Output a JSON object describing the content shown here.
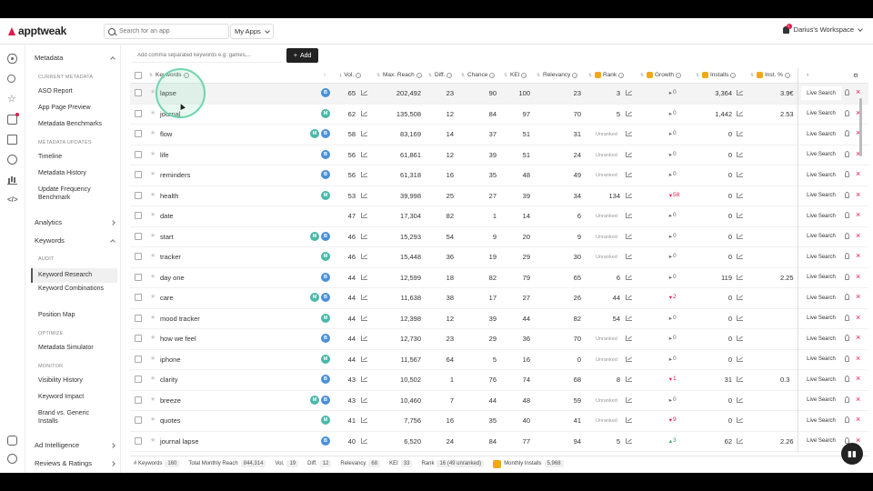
{
  "app": {
    "logo_text": "apptweak"
  },
  "topbar": {
    "search_placeholder": "Search for an app",
    "my_apps_label": "My Apps",
    "notification_count": "1",
    "workspace_label": "Darius's Workspace"
  },
  "rail_icons": [
    "eye-icon",
    "search-icon",
    "star-icon",
    "chat-icon",
    "box-icon",
    "clock-icon",
    "bar-chart-icon",
    "code-icon",
    "robot-icon",
    "user-icon"
  ],
  "nav": {
    "metadata": "Metadata",
    "current_metadata": "CURRENT METADATA",
    "aso_report": "ASO Report",
    "app_page_preview": "App Page Preview",
    "metadata_benchmarks": "Metadata Benchmarks",
    "metadata_updates": "METADATA UPDATES",
    "timeline": "Timeline",
    "metadata_history": "Metadata History",
    "update_frequency": "Update Frequency Benchmark",
    "analytics": "Analytics",
    "keywords": "Keywords",
    "audit": "AUDIT",
    "keyword_research": "Keyword Research",
    "keyword_combinations": "Keyword Combinations",
    "position_map": "Position Map",
    "optimize": "OPTIMIZE",
    "metadata_simulator": "Metadata Simulator",
    "monitor": "MONITOR",
    "visibility_history": "Visibility History",
    "keyword_impact": "Keyword Impact",
    "brand_vs_generic": "Brand vs. Generic Installs",
    "ad_intelligence": "Ad Intelligence",
    "reviews_ratings": "Reviews & Ratings"
  },
  "add_bar": {
    "placeholder": "Add comma separated keywords e.g: games,...",
    "button_label": "Add",
    "button_icon": "+"
  },
  "columns": {
    "keywords": "Keywords",
    "vol": "Vol.",
    "max_reach": "Max. Reach",
    "diff": "Diff.",
    "chance": "Chance",
    "kei": "KEI",
    "relevancy": "Relevancy",
    "rank": "Rank",
    "growth": "Growth",
    "installs": "Installs",
    "inst_pct": "Inst. %"
  },
  "row_action": {
    "live_search": "Live Search",
    "delete": "×"
  },
  "rows": [
    {
      "kw": "lapse",
      "badges": [
        "B"
      ],
      "vol": "65",
      "reach": "202,492",
      "diff": "23",
      "chance": "90",
      "kei": "100",
      "rel": "23",
      "rank": "3",
      "growth": "0",
      "gtype": "zero",
      "installs": "3,364",
      "instp": "3.9€"
    },
    {
      "kw": "journal",
      "badges": [
        "M"
      ],
      "vol": "62",
      "reach": "135,508",
      "diff": "12",
      "chance": "84",
      "kei": "97",
      "rel": "70",
      "rank": "5",
      "growth": "0",
      "gtype": "zero",
      "installs": "1,442",
      "instp": "2.53"
    },
    {
      "kw": "flow",
      "badges": [
        "M",
        "B"
      ],
      "vol": "58",
      "reach": "83,169",
      "diff": "14",
      "chance": "37",
      "kei": "51",
      "rel": "31",
      "rank": "Unranked",
      "growth": "0",
      "gtype": "zero",
      "installs": "0",
      "instp": ""
    },
    {
      "kw": "life",
      "badges": [
        "B"
      ],
      "vol": "56",
      "reach": "61,861",
      "diff": "12",
      "chance": "39",
      "kei": "51",
      "rel": "24",
      "rank": "Unranked",
      "growth": "0",
      "gtype": "zero",
      "installs": "0",
      "instp": ""
    },
    {
      "kw": "reminders",
      "badges": [
        "B"
      ],
      "vol": "56",
      "reach": "61,318",
      "diff": "16",
      "chance": "35",
      "kei": "48",
      "rel": "49",
      "rank": "Unranked",
      "growth": "0",
      "gtype": "zero",
      "installs": "0",
      "instp": ""
    },
    {
      "kw": "health",
      "badges": [
        "M"
      ],
      "vol": "53",
      "reach": "39,998",
      "diff": "25",
      "chance": "27",
      "kei": "39",
      "rel": "34",
      "rank": "134",
      "growth": "58",
      "gtype": "neg",
      "installs": "0",
      "instp": ""
    },
    {
      "kw": "date",
      "badges": [],
      "vol": "47",
      "reach": "17,304",
      "diff": "82",
      "chance": "1",
      "kei": "14",
      "rel": "6",
      "rank": "Unranked",
      "growth": "0",
      "gtype": "zero",
      "installs": "0",
      "instp": ""
    },
    {
      "kw": "start",
      "badges": [
        "M",
        "B"
      ],
      "vol": "46",
      "reach": "15,293",
      "diff": "54",
      "chance": "9",
      "kei": "20",
      "rel": "9",
      "rank": "Unranked",
      "growth": "0",
      "gtype": "zero",
      "installs": "0",
      "instp": ""
    },
    {
      "kw": "tracker",
      "badges": [
        "M"
      ],
      "vol": "46",
      "reach": "15,448",
      "diff": "36",
      "chance": "19",
      "kei": "29",
      "rel": "30",
      "rank": "Unranked",
      "growth": "0",
      "gtype": "zero",
      "installs": "0",
      "instp": ""
    },
    {
      "kw": "day one",
      "badges": [
        "B"
      ],
      "vol": "44",
      "reach": "12,599",
      "diff": "18",
      "chance": "82",
      "kei": "79",
      "rel": "65",
      "rank": "6",
      "growth": "0",
      "gtype": "zero",
      "installs": "119",
      "instp": "2.25"
    },
    {
      "kw": "care",
      "badges": [
        "M",
        "B"
      ],
      "vol": "44",
      "reach": "11,638",
      "diff": "38",
      "chance": "17",
      "kei": "27",
      "rel": "26",
      "rank": "44",
      "growth": "2",
      "gtype": "neg",
      "installs": "0",
      "instp": ""
    },
    {
      "kw": "mood tracker",
      "badges": [
        "M"
      ],
      "vol": "44",
      "reach": "12,398",
      "diff": "12",
      "chance": "39",
      "kei": "44",
      "rel": "82",
      "rank": "54",
      "growth": "0",
      "gtype": "zero",
      "installs": "0",
      "instp": ""
    },
    {
      "kw": "how we feel",
      "badges": [
        "B"
      ],
      "vol": "44",
      "reach": "12,730",
      "diff": "23",
      "chance": "29",
      "kei": "36",
      "rel": "70",
      "rank": "Unranked",
      "growth": "0",
      "gtype": "zero",
      "installs": "0",
      "instp": ""
    },
    {
      "kw": "iphone",
      "badges": [
        "M"
      ],
      "vol": "44",
      "reach": "11,567",
      "diff": "64",
      "chance": "5",
      "kei": "16",
      "rel": "0",
      "rank": "Unranked",
      "growth": "0",
      "gtype": "zero",
      "installs": "0",
      "instp": ""
    },
    {
      "kw": "clarity",
      "badges": [
        "B"
      ],
      "vol": "43",
      "reach": "10,502",
      "diff": "1",
      "chance": "76",
      "kei": "74",
      "rel": "68",
      "rank": "8",
      "growth": "1",
      "gtype": "neg",
      "installs": "31",
      "instp": "0.3"
    },
    {
      "kw": "breeze",
      "badges": [
        "M",
        "B"
      ],
      "vol": "43",
      "reach": "10,460",
      "diff": "7",
      "chance": "44",
      "kei": "48",
      "rel": "59",
      "rank": "Unranked",
      "growth": "0",
      "gtype": "zero",
      "installs": "0",
      "instp": ""
    },
    {
      "kw": "quotes",
      "badges": [
        "M"
      ],
      "vol": "41",
      "reach": "7,756",
      "diff": "16",
      "chance": "35",
      "kei": "40",
      "rel": "41",
      "rank": "Unranked",
      "growth": "9",
      "gtype": "neg",
      "installs": "0",
      "instp": ""
    },
    {
      "kw": "journal lapse",
      "badges": [
        "B"
      ],
      "vol": "40",
      "reach": "6,520",
      "diff": "24",
      "chance": "84",
      "kei": "77",
      "rel": "94",
      "rank": "5",
      "growth": "3",
      "gtype": "pos",
      "installs": "62",
      "instp": "2.26"
    }
  ],
  "footer": {
    "keywords_label": "# Keywords",
    "keywords_val": "160",
    "reach_label": "Total Monthly Reach",
    "reach_val": "844,314",
    "vol_label": "Vol.",
    "vol_val": "19",
    "diff_label": "Diff.",
    "diff_val": "12",
    "rel_label": "Relevancy",
    "rel_val": "68",
    "kei_label": "KEI",
    "kei_val": "33",
    "rank_label": "Rank",
    "rank_val": "16 (49 unranked)",
    "installs_label": "Monthly Installs",
    "installs_val": "5,968"
  },
  "colors": {
    "brand": "#e0194b",
    "badge_m": "#4bb8a9",
    "badge_b": "#4a90d9",
    "coin": "#f2a71b"
  }
}
